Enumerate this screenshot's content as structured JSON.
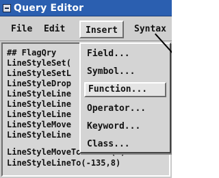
{
  "window": {
    "title": "Query Editor"
  },
  "menubar": {
    "items": [
      {
        "label": "File"
      },
      {
        "label": "Edit"
      },
      {
        "label": "Insert"
      },
      {
        "label": "Syntax"
      }
    ]
  },
  "editor": {
    "lines": [
      "## FlagQry",
      "LineStyleSet(",
      "LineStyleSetL",
      "LineStyleDrop",
      "LineStyleLine",
      "LineStyleLine",
      "LineStyleLine",
      "LineStyleMove",
      "LineStyleLine",
      "LineStyleMoveToAnchor(1)",
      "LineStyleLineTo(-135,8)"
    ]
  },
  "insert_menu": {
    "items": [
      {
        "label": "Field..."
      },
      {
        "label": "Symbol..."
      },
      {
        "label": "Function...",
        "highlighted": true
      },
      {
        "label": "Operator..."
      },
      {
        "label": "Keyword..."
      },
      {
        "label": "Class..."
      }
    ]
  }
}
